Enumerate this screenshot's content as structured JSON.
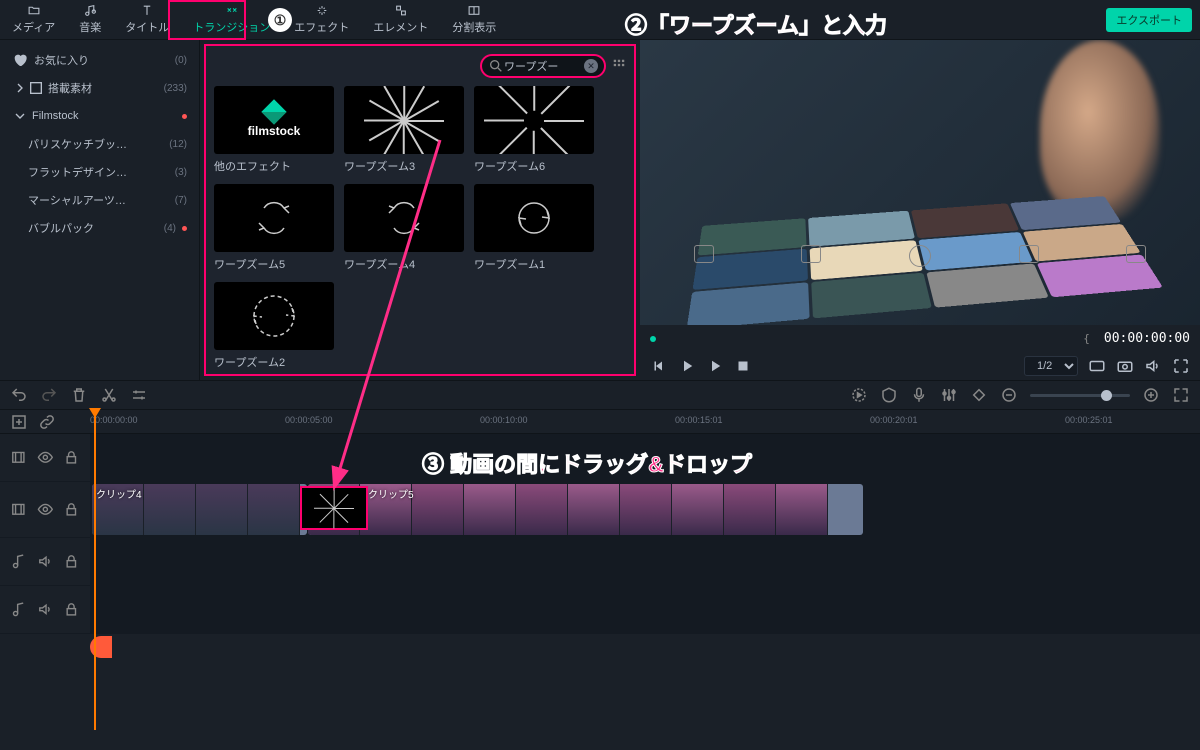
{
  "tabs": {
    "media": "メディア",
    "audio": "音楽",
    "title": "タイトル",
    "transition": "トランジション",
    "effect": "エフェクト",
    "element": "エレメント",
    "split": "分割表示"
  },
  "export_btn": "エクスポート",
  "sidebar": {
    "fav": {
      "label": "お気に入り",
      "count": "(0)"
    },
    "builtin": {
      "label": "搭載素材",
      "count": "(233)"
    },
    "filmstock": {
      "label": "Filmstock"
    },
    "items": [
      {
        "label": "パリスケッチブッ…",
        "count": "(12)"
      },
      {
        "label": "フラットデザイン…",
        "count": "(3)"
      },
      {
        "label": "マーシャルアーツ…",
        "count": "(7)"
      },
      {
        "label": "バブルパック",
        "count": "(4)"
      }
    ]
  },
  "search": {
    "value": "ワープズー"
  },
  "transitions": [
    {
      "name": "他のエフェクト",
      "kind": "filmstock"
    },
    {
      "name": "ワープズーム3",
      "kind": "zoom-out"
    },
    {
      "name": "ワープズーム6",
      "kind": "zoom-in"
    },
    {
      "name": "ワープズーム5",
      "kind": "spin"
    },
    {
      "name": "ワープズーム4",
      "kind": "spin"
    },
    {
      "name": "ワープズーム1",
      "kind": "spin"
    },
    {
      "name": "ワープズーム2",
      "kind": "spin-big"
    }
  ],
  "preview": {
    "timecode": "00:00:00:00",
    "ratio": "1/2"
  },
  "ruler": [
    "00:00:00:00",
    "00:00:05:00",
    "00:00:10:00",
    "00:00:15:01",
    "00:00:20:01",
    "00:00:25:01"
  ],
  "clips": {
    "c1": "クリップ4",
    "c2": "クリップ5"
  },
  "annotations": {
    "a1": "①",
    "a2": "②「ワープズーム」と入力",
    "a3": "③ 動画の間にドラッグ&ドロップ"
  }
}
